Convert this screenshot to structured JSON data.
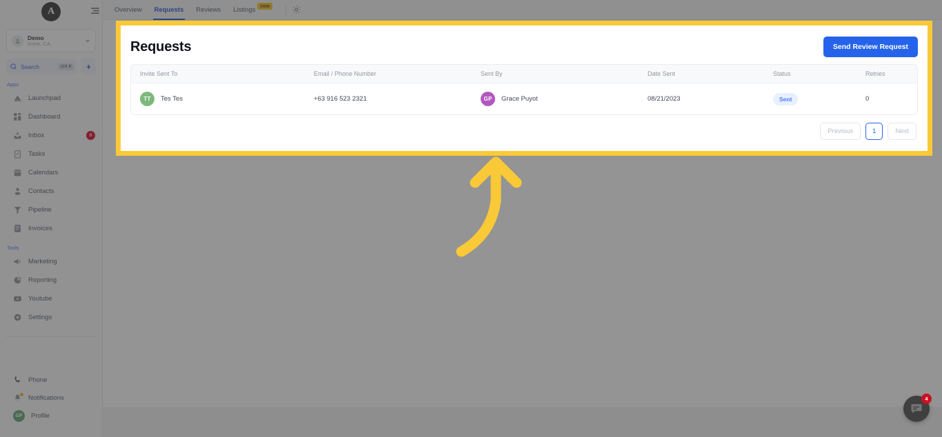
{
  "sidebar": {
    "brand_initial": "A",
    "workspace": {
      "name": "Demo",
      "location": "Irvine, CA"
    },
    "search": {
      "label": "Search",
      "shortcut": "ctrl K"
    },
    "section_apps": "Apps",
    "section_tools": "Tools",
    "apps": [
      {
        "label": "Launchpad",
        "icon": "launchpad-icon",
        "badge": ""
      },
      {
        "label": "Dashboard",
        "icon": "dashboard-icon",
        "badge": ""
      },
      {
        "label": "Inbox",
        "icon": "inbox-icon",
        "badge": "0"
      },
      {
        "label": "Tasks",
        "icon": "tasks-icon",
        "badge": ""
      },
      {
        "label": "Calendars",
        "icon": "calendar-icon",
        "badge": ""
      },
      {
        "label": "Contacts",
        "icon": "contacts-icon",
        "badge": ""
      },
      {
        "label": "Pipeline",
        "icon": "pipeline-icon",
        "badge": ""
      },
      {
        "label": "Invoices",
        "icon": "invoices-icon",
        "badge": ""
      }
    ],
    "tools": [
      {
        "label": "Marketing",
        "icon": "megaphone-icon"
      },
      {
        "label": "Reporting",
        "icon": "pie-chart-icon"
      },
      {
        "label": "Youtube",
        "icon": "youtube-icon"
      },
      {
        "label": "Settings",
        "icon": "gear-icon"
      }
    ],
    "bottom": [
      {
        "label": "Phone",
        "icon": "phone-icon"
      },
      {
        "label": "Notifications",
        "icon": "bell-icon"
      },
      {
        "label": "Profile",
        "icon": "avatar-initials",
        "initials": "GP"
      }
    ]
  },
  "topbar": {
    "tabs": [
      {
        "label": "Overview",
        "active": false,
        "badge": ""
      },
      {
        "label": "Requests",
        "active": true,
        "badge": ""
      },
      {
        "label": "Reviews",
        "active": false,
        "badge": ""
      },
      {
        "label": "Listings",
        "active": false,
        "badge": "new"
      }
    ],
    "settings_icon": "gear-icon",
    "menu_icon": "hamburger-icon"
  },
  "card": {
    "title": "Requests",
    "primary_button": "Send Review Request",
    "table": {
      "columns": [
        "Invite Sent To",
        "Email / Phone Number",
        "Sent By",
        "Date Sent",
        "Status",
        "Retries"
      ],
      "rows": [
        {
          "invite_initials": "TT",
          "invite_name": "Tes Tes",
          "contact": "+63 916 523 2321",
          "sender_initials": "GP",
          "sender_name": "Grace Puyot",
          "date_sent": "08/21/2023",
          "status": "Sent",
          "retries": "0"
        }
      ]
    },
    "pagination": {
      "previous": "Previous",
      "page": "1",
      "next": "Next"
    }
  },
  "chat_widget": {
    "icon": "chat-bubble-icon",
    "unread": "4"
  },
  "annotation": {
    "type": "curved-arrow",
    "color": "#fac937",
    "points_to": "requests-card"
  },
  "colors": {
    "accent_blue": "#2563eb",
    "highlight_yellow": "#fac937",
    "status_pill_bg": "#e8efff",
    "status_pill_text": "#4a7dfa",
    "badge_red": "#d80027",
    "avatar_green": "#7cb97c",
    "avatar_purple": "#b158c0"
  }
}
